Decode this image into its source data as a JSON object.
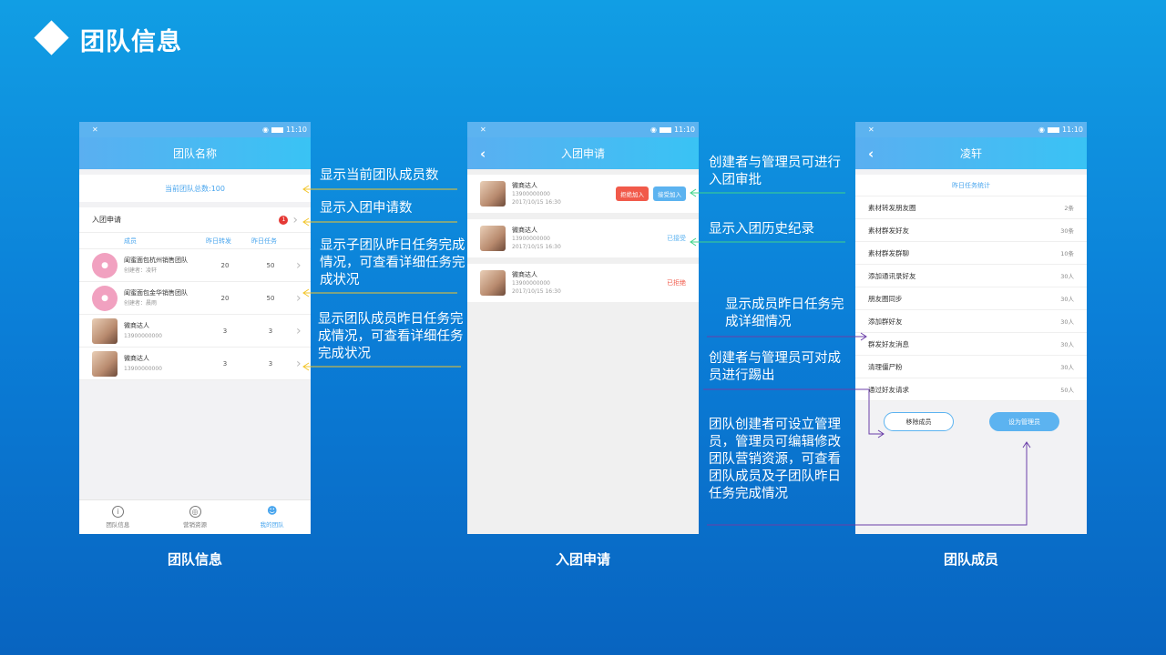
{
  "slide": {
    "title": "团队信息"
  },
  "status": {
    "time": "11:10"
  },
  "screen1": {
    "nav_title": "团队名称",
    "total_label": "当前团队总数:100",
    "apply_label": "入团申请",
    "apply_badge": "1",
    "headers": {
      "member": "成员",
      "forward": "昨日转发",
      "task": "昨日任务"
    },
    "rows": [
      {
        "avatar": "pink",
        "name": "闺蜜面包杭州销售团队",
        "sub": "创建者：凌轩",
        "forward": "20",
        "task": "50"
      },
      {
        "avatar": "pink",
        "name": "闺蜜面包金华销售团队",
        "sub": "创建者：晨雨",
        "forward": "20",
        "task": "50"
      },
      {
        "avatar": "photo",
        "name": "微商达人",
        "sub": "13900000000",
        "forward": "3",
        "task": "3"
      },
      {
        "avatar": "photo",
        "name": "微商达人",
        "sub": "13900000000",
        "forward": "3",
        "task": "3"
      }
    ],
    "tabs": [
      {
        "label": "团队信息",
        "icon": "info-icon"
      },
      {
        "label": "营销资源",
        "icon": "globe-icon"
      },
      {
        "label": "我的团队",
        "icon": "team-icon"
      }
    ],
    "caption": "团队信息"
  },
  "screen2": {
    "nav_title": "入团申请",
    "items": [
      {
        "name": "微商达人",
        "phone": "13900000000",
        "time": "2017/10/15  16:30"
      },
      {
        "name": "微商达人",
        "phone": "13900000000",
        "time": "2017/10/15  16:30",
        "status": "已接受"
      },
      {
        "name": "微商达人",
        "phone": "13900000000",
        "time": "2017/10/15  16:30",
        "status": "已拒绝"
      }
    ],
    "reject_label": "拒绝加入",
    "accept_label": "接受加入",
    "caption": "入团申请"
  },
  "screen3": {
    "nav_title": "凌轩",
    "section_title": "昨日任务统计",
    "stats": [
      {
        "label": "素材转发朋友圈",
        "value": "2条"
      },
      {
        "label": "素材群发好友",
        "value": "30条"
      },
      {
        "label": "素材群发群聊",
        "value": "10条"
      },
      {
        "label": "添加通讯录好友",
        "value": "30人"
      },
      {
        "label": "朋友圈同步",
        "value": "30人"
      },
      {
        "label": "添加群好友",
        "value": "30人"
      },
      {
        "label": "群发好友消息",
        "value": "30人"
      },
      {
        "label": "清理僵尸粉",
        "value": "30人"
      },
      {
        "label": "通过好友请求",
        "value": "50人"
      }
    ],
    "remove_label": "移除成员",
    "admin_label": "设为管理员",
    "caption": "团队成员"
  },
  "annotations": {
    "a1": "显示当前团队成员数",
    "a2": "显示入团申请数",
    "a3": "显示子团队昨日任务完成情况，可查看详细任务完成状况",
    "a4": "显示团队成员昨日任务完成情况，可查看详细任务完成状况",
    "b1": "创建者与管理员可进行入团审批",
    "b2": "显示入团历史纪录",
    "c1": "显示成员昨日任务完成详细情况",
    "c2": "创建者与管理员可对成员进行踢出",
    "c3": "团队创建者可设立管理员，管理员可编辑修改团队营销资源，可查看团队成员及子团队昨日任务完成情况"
  },
  "colors": {
    "line_yellow": "#f2c52b",
    "line_green": "#3fd48a",
    "line_purple": "#6b3fa8",
    "reject": "#f15a4a",
    "accept": "#5cb3f0"
  }
}
